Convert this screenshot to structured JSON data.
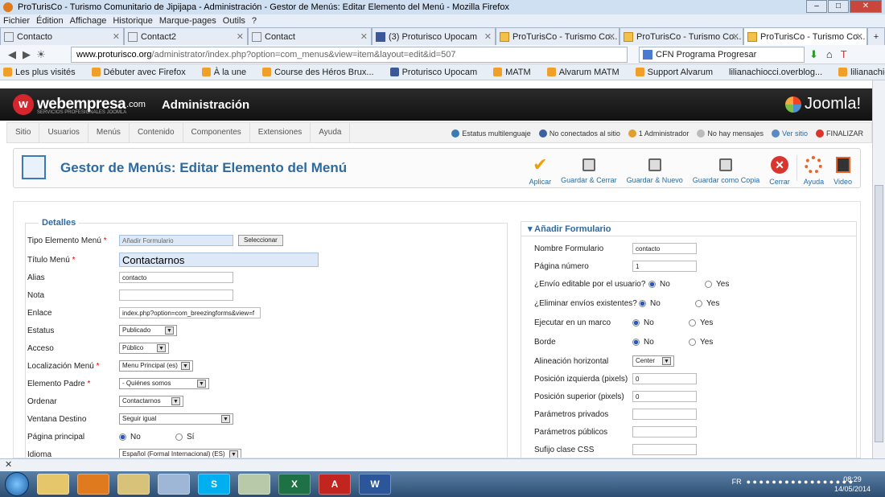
{
  "window": {
    "title": "ProTurisCo - Turismo Comunitario de Jipijapa - Administración - Gestor de Menús: Editar Elemento del Menú - Mozilla Firefox"
  },
  "menubar": [
    "Fichier",
    "Édition",
    "Affichage",
    "Historique",
    "Marque-pages",
    "Outils",
    "?"
  ],
  "tabs": [
    {
      "label": "Contacto",
      "icon": "page-icon"
    },
    {
      "label": "Contact2",
      "icon": "page-icon"
    },
    {
      "label": "Contact",
      "icon": "page-icon"
    },
    {
      "label": "(3) Proturisco Upocam",
      "icon": "facebook-icon"
    },
    {
      "label": "ProTurisCo - Turismo Co...",
      "icon": "proturisco-icon"
    },
    {
      "label": "ProTurisCo - Turismo Co...",
      "icon": "proturisco-icon"
    },
    {
      "label": "ProTurisCo - Turismo Co...",
      "icon": "proturisco-icon"
    }
  ],
  "address": {
    "domain": "www.proturisco.org",
    "path": "/administrator/index.php?option=com_menus&view=item&layout=edit&id=507"
  },
  "search": {
    "value": "CFN Programa Progresar"
  },
  "bookmarks": [
    "Les plus visités",
    "Débuter avec Firefox",
    "À la une",
    "Course des Héros Brux...",
    "Proturisco Upocam",
    "MATM",
    "Alvarum MATM",
    "Support Alvarum",
    "lilianachiocci.overblog...",
    "lilianachiocci.overblog..."
  ],
  "joomla_header": {
    "brand": "webempresa",
    "brand_tld": ".com",
    "brand_sub": "SERVICIOS PROFESIONALES JOOMLA",
    "section": "Administración",
    "joomla_logo": "Joomla!"
  },
  "admin_menu": [
    "Sitio",
    "Usuarios",
    "Menús",
    "Contenido",
    "Componentes",
    "Extensiones",
    "Ayuda"
  ],
  "admin_status": [
    "Estatus multilenguaje",
    "No conectados al sitio",
    "1 Administrador",
    "No hay mensajes",
    "Ver sitio",
    "FINALIZAR"
  ],
  "page_title": "Gestor de Menús: Editar Elemento del Menú",
  "toolbar": [
    "Aplicar",
    "Guardar & Cerrar",
    "Guardar & Nuevo",
    "Guardar como Copia",
    "Cerrar",
    "Ayuda",
    "Video"
  ],
  "details": {
    "legend": "Detalles",
    "tipo_label": "Tipo Elemento Menú",
    "tipo_value": "Añadir Formulario",
    "select_button": "Seleccionar",
    "titulo_label": "Título Menú",
    "titulo_value": "Contactarnos",
    "alias_label": "Alias",
    "alias_value": "contacto",
    "nota_label": "Nota",
    "nota_value": "",
    "enlace_label": "Enlace",
    "enlace_value": "index.php?option=com_breezingforms&view=f",
    "estatus_label": "Estatus",
    "estatus_value": "Publicado",
    "acceso_label": "Acceso",
    "acceso_value": "Público",
    "loc_label": "Localización Menú",
    "loc_value": "Menu Principal (es)",
    "padre_label": "Elemento Padre",
    "padre_value": "- Quiénes somos",
    "ordenar_label": "Ordenar",
    "ordenar_value": "Contactarnos",
    "ventana_label": "Ventana Destino",
    "ventana_value": "Seguir igual",
    "principal_label": "Página principal",
    "principal_no": "No",
    "principal_si": "Sí",
    "idioma_label": "Idioma",
    "idioma_value": "Español (Formal Internacional) (ES)"
  },
  "form_panel": {
    "heading": "Añadir Formulario",
    "nombre_label": "Nombre Formulario",
    "nombre_value": "contacto",
    "pagina_label": "Página número",
    "pagina_value": "1",
    "editable_label": "¿Envío editable por el usuario?",
    "editable_no": "No",
    "editable_si": "Yes",
    "eliminar_label": "¿Eliminar envíos existentes?",
    "eliminar_no": "No",
    "eliminar_si": "Yes",
    "marco_label": "Ejecutar en un marco",
    "marco_no": "No",
    "marco_si": "Yes",
    "borde_label": "Borde",
    "borde_no": "No",
    "borde_si": "Yes",
    "alineacion_label": "Alineación horizontal",
    "alineacion_value": "Center",
    "posizq_label": "Posición izquierda (pixels)",
    "posizq_value": "0",
    "possup_label": "Posición superior (pixels)",
    "possup_value": "0",
    "privados_label": "Parámetros privados",
    "privados_value": "",
    "publicos_label": "Parámetros públicos",
    "publicos_value": "",
    "sufijo_label": "Sufijo clase CSS",
    "sufijo_value": ""
  },
  "taskbar": {
    "lang": "FR",
    "time": "08:29",
    "date": "14/05/2014"
  },
  "colors": {
    "accent": "#2c6aa0",
    "cancel": "#d9352e",
    "apply": "#f29f05"
  }
}
